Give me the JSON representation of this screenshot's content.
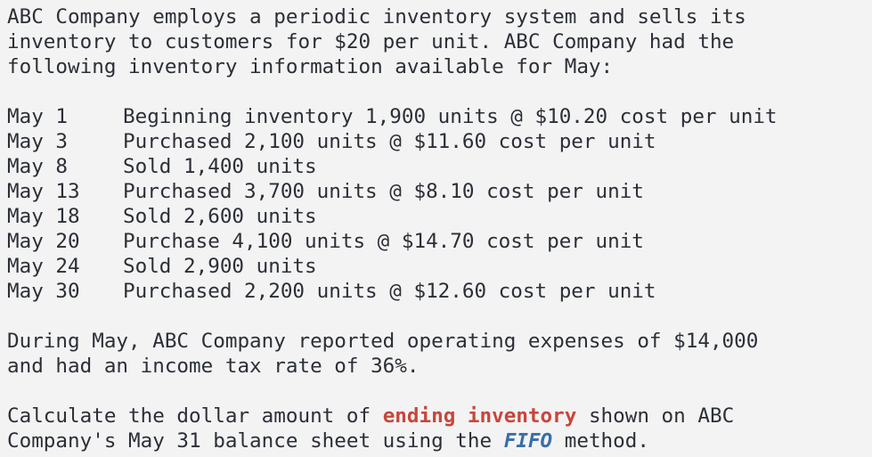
{
  "intro": "ABC Company employs a periodic inventory system and sells its\ninventory to customers for $20 per unit. ABC Company had the\nfollowing inventory information available for May:",
  "transactions": [
    {
      "date": "May 1",
      "desc": "Beginning inventory 1,900 units @ $10.20 cost per unit"
    },
    {
      "date": "May 3",
      "desc": "Purchased 2,100 units @ $11.60 cost per unit"
    },
    {
      "date": "May 8",
      "desc": "Sold 1,400 units"
    },
    {
      "date": "May 13",
      "desc": "Purchased 3,700 units @ $8.10 cost per unit"
    },
    {
      "date": "May 18",
      "desc": "Sold 2,600 units"
    },
    {
      "date": "May 20",
      "desc": "Purchase 4,100 units @ $14.70 cost per unit"
    },
    {
      "date": "May 24",
      "desc": "Sold 2,900 units"
    },
    {
      "date": "May 30",
      "desc": "Purchased 2,200 units @ $12.60 cost per unit"
    }
  ],
  "expenses": "During May, ABC Company reported operating expenses of $14,000\nand had an income tax rate of 36%.",
  "question": {
    "part1": "Calculate the dollar amount of ",
    "highlight1": "ending inventory",
    "part2": " shown on ABC\nCompany's May 31 balance sheet using the ",
    "highlight2": "FIFO",
    "part3": " method."
  },
  "colors": {
    "highlight_red": "#c8463a",
    "highlight_blue": "#3a6ea8"
  }
}
